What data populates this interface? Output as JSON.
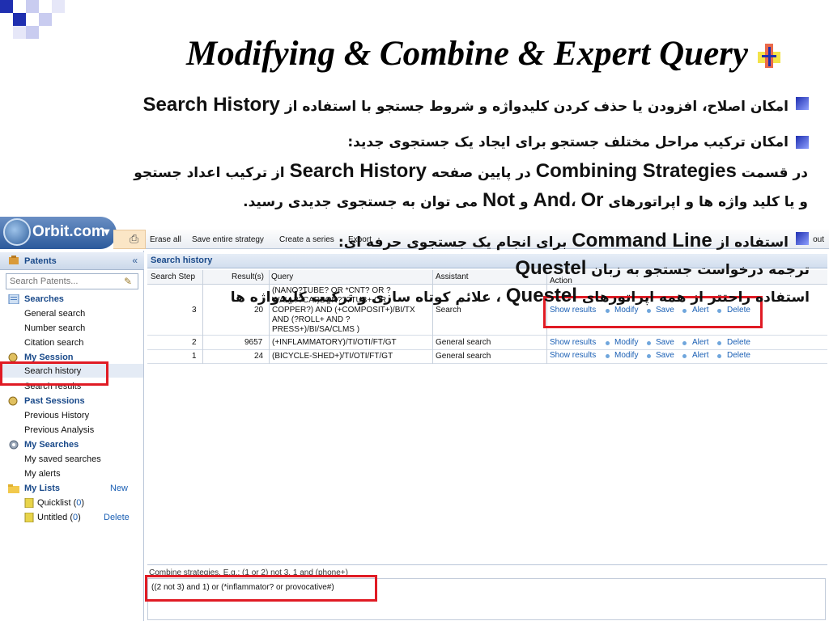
{
  "slide": {
    "title": "Modifying & Combine & Expert Query",
    "colors": {
      "bullet": "#1f2fb0",
      "highlight": "#e01b24",
      "orbit_blue": "#2b5a9c"
    },
    "bullets": [
      {
        "text": "امکان اصلاح، افزودن یا حذف کردن کلیدواژه و شروط جستجو با استفاده از",
        "bold": "Search History"
      },
      {
        "text": "امکان ترکیب مراحل مختلف جستجو برای ایجاد یک جستجوی جدید:"
      }
    ],
    "para2": {
      "l1_a": "در قسمت",
      "l1_b": "Combining Strategies",
      "l1_c": "در پایین صفحه",
      "l1_d": "Search History",
      "l1_e": "از ترکیب اعداد جستجو",
      "l2_a": "و یا کلید واژه ها و اپراتورهای",
      "l2_b": "And",
      "l2_c": "،",
      "l2_d": "Or",
      "l2_e": "و",
      "l2_f": "Not",
      "l2_g": "می توان به جستجوی جدیدی رسید."
    },
    "overlay": {
      "l1_a": "استفاده از",
      "l1_b": "Command Line",
      "l1_c": "برای انجام یک جستجوی حرفه ای:",
      "l2_a": "ترجمه درخواست جستجو به زبان",
      "l2_b": "Questel",
      "l3_a": "استفاده راحتتر از همه اپراتورهای",
      "l3_b": "Questel",
      "l3_c": "، علائم کوتاه سازی و ترکیب کلیدواژه ها"
    }
  },
  "app": {
    "logo": "Orbit.com",
    "toolbar": {
      "erase_all": "Erase all",
      "save_strategy": "Save entire strategy",
      "create_series": "Create a series",
      "export": "Export",
      "logout": "out"
    },
    "sidebar": {
      "header": "Patents",
      "collapse": "«",
      "search_placeholder": "Search Patents...",
      "sections": {
        "searches": "Searches",
        "general_search": "General search",
        "number_search": "Number search",
        "citation_search": "Citation search",
        "my_session": "My Session",
        "search_history": "Search history",
        "search_results": "Search results",
        "past_sessions": "Past Sessions",
        "previous_history": "Previous History",
        "previous_analysis": "Previous Analysis",
        "my_searches": "My Searches",
        "my_saved_searches": "My saved searches",
        "my_alerts": "My alerts",
        "my_lists": "My Lists",
        "new": "New",
        "quicklist": "Quicklist (",
        "quicklist_count": "0",
        "quicklist_close": ")",
        "untitled": "Untitled (",
        "untitled_count": "0",
        "untitled_close": ")",
        "delete": "Delete"
      }
    },
    "history": {
      "title": "Search history",
      "columns": {
        "step": "Search Step",
        "result": "Result(s)",
        "query": "Query",
        "assistant": "Assistant",
        "action": "Action"
      },
      "rows": [
        {
          "step": "3",
          "result": "20",
          "query": [
            "(NANO?TUBE? OR *CNT? OR ?",
            "WALL??CARBON???TUB+ OR",
            "COPPER?) AND (+COMPOSIT+)/BI/TX",
            "AND (?ROLL+ AND ?",
            "PRESS+)/BI/SA/CLMS )"
          ],
          "assistant": "Search"
        },
        {
          "step": "2",
          "result": "9657",
          "query": [
            "(+INFLAMMATORY)/TI/OTI/FT/GT"
          ],
          "assistant": "General search"
        },
        {
          "step": "1",
          "result": "24",
          "query": [
            "(BICYCLE-SHED+)/TI/OTI/FT/GT"
          ],
          "assistant": "General search"
        }
      ],
      "actions": {
        "show": "Show results",
        "modify": "Modify",
        "save": "Save",
        "alert": "Alert",
        "delete": "Delete"
      }
    },
    "combine": {
      "hint": "Combine strategies. E.g.: (1 or 2) not 3, 1 and (phone+)",
      "value": "((2 not 3) and 1) or (*inflammator? or provocative#)"
    }
  }
}
